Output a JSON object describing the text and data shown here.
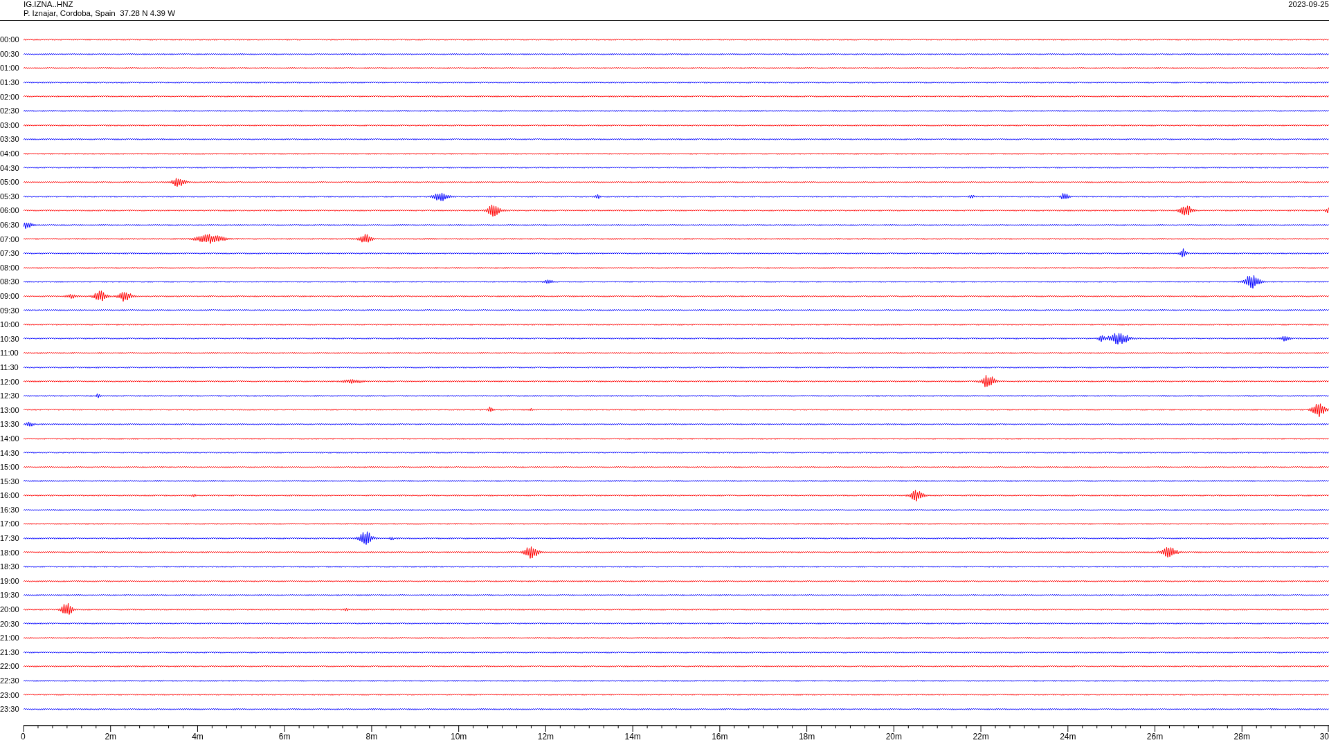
{
  "header": {
    "station": "IG.IZNA..HNZ",
    "location": "P. Iznajar, Cordoba, Spain  37.28 N 4.39 W",
    "date": "2023-09-25"
  },
  "rows": [
    {
      "label": "00:00",
      "color": "#ff0000"
    },
    {
      "label": "00:30",
      "color": "#0000ff"
    },
    {
      "label": "01:00",
      "color": "#ff0000"
    },
    {
      "label": "01:30",
      "color": "#0000ff"
    },
    {
      "label": "02:00",
      "color": "#ff0000"
    },
    {
      "label": "02:30",
      "color": "#0000ff"
    },
    {
      "label": "03:00",
      "color": "#ff0000"
    },
    {
      "label": "03:30",
      "color": "#0000ff"
    },
    {
      "label": "04:00",
      "color": "#ff0000"
    },
    {
      "label": "04:30",
      "color": "#0000ff"
    },
    {
      "label": "05:00",
      "color": "#ff0000"
    },
    {
      "label": "05:30",
      "color": "#0000ff"
    },
    {
      "label": "06:00",
      "color": "#ff0000"
    },
    {
      "label": "06:30",
      "color": "#0000ff"
    },
    {
      "label": "07:00",
      "color": "#ff0000"
    },
    {
      "label": "07:30",
      "color": "#0000ff"
    },
    {
      "label": "08:00",
      "color": "#ff0000"
    },
    {
      "label": "08:30",
      "color": "#0000ff"
    },
    {
      "label": "09:00",
      "color": "#ff0000"
    },
    {
      "label": "09:30",
      "color": "#0000ff"
    },
    {
      "label": "10:00",
      "color": "#ff0000"
    },
    {
      "label": "10:30",
      "color": "#0000ff"
    },
    {
      "label": "11:00",
      "color": "#ff0000"
    },
    {
      "label": "11:30",
      "color": "#0000ff"
    },
    {
      "label": "12:00",
      "color": "#ff0000"
    },
    {
      "label": "12:30",
      "color": "#0000ff"
    },
    {
      "label": "13:00",
      "color": "#ff0000"
    },
    {
      "label": "13:30",
      "color": "#0000ff"
    },
    {
      "label": "14:00",
      "color": "#ff0000"
    },
    {
      "label": "14:30",
      "color": "#0000ff"
    },
    {
      "label": "15:00",
      "color": "#ff0000"
    },
    {
      "label": "15:30",
      "color": "#0000ff"
    },
    {
      "label": "16:00",
      "color": "#ff0000"
    },
    {
      "label": "16:30",
      "color": "#0000ff"
    },
    {
      "label": "17:00",
      "color": "#ff0000"
    },
    {
      "label": "17:30",
      "color": "#0000ff"
    },
    {
      "label": "18:00",
      "color": "#ff0000"
    },
    {
      "label": "18:30",
      "color": "#0000ff"
    },
    {
      "label": "19:00",
      "color": "#ff0000"
    },
    {
      "label": "19:30",
      "color": "#0000ff"
    },
    {
      "label": "20:00",
      "color": "#ff0000"
    },
    {
      "label": "20:30",
      "color": "#0000ff"
    },
    {
      "label": "21:00",
      "color": "#ff0000"
    },
    {
      "label": "21:30",
      "color": "#0000ff"
    },
    {
      "label": "22:00",
      "color": "#ff0000"
    },
    {
      "label": "22:30",
      "color": "#0000ff"
    },
    {
      "label": "23:00",
      "color": "#ff0000"
    },
    {
      "label": "23:30",
      "color": "#0000ff"
    }
  ],
  "x_axis": {
    "labels": [
      "0",
      "2m",
      "4m",
      "6m",
      "8m",
      "10m",
      "12m",
      "14m",
      "16m",
      "18m",
      "20m",
      "22m",
      "24m",
      "26m",
      "28m",
      "30"
    ]
  }
}
